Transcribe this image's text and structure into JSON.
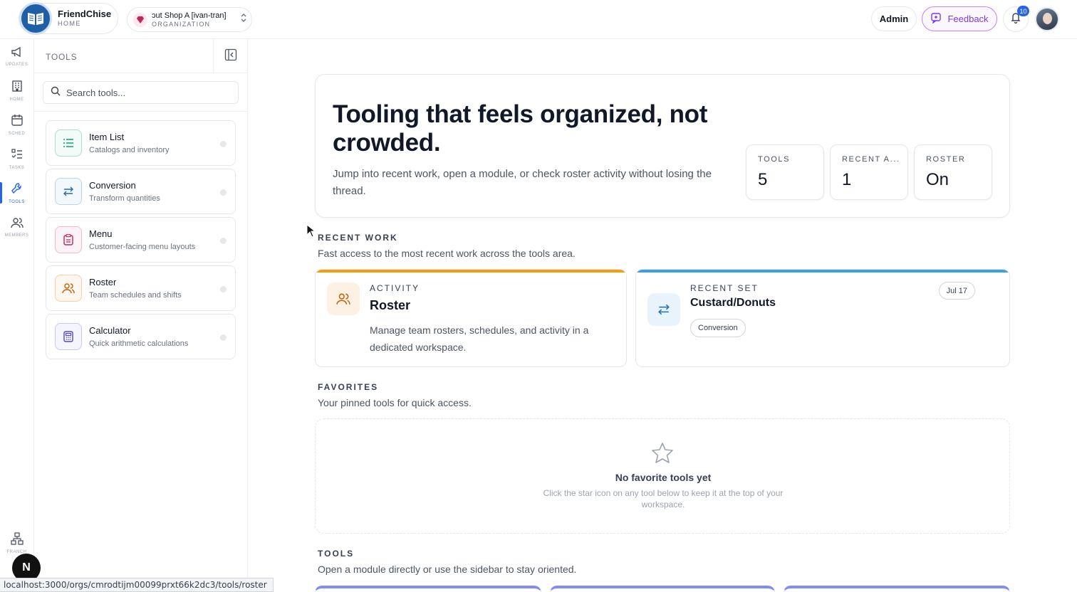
{
  "brand": {
    "name": "FriendChise",
    "subtitle": "HOME"
  },
  "org": {
    "name": "ɔut Shop A [ivan-tran]",
    "subtitle": "ORGANIZATION"
  },
  "header": {
    "admin_label": "Admin",
    "feedback_label": "Feedback",
    "notification_count": "10"
  },
  "rail": {
    "items": [
      {
        "label": "UPDATES",
        "icon": "megaphone-icon"
      },
      {
        "label": "HOME",
        "icon": "building-icon"
      },
      {
        "label": "SCHED",
        "icon": "calendar-icon"
      },
      {
        "label": "TASKS",
        "icon": "task-list-icon"
      },
      {
        "label": "TOOLS",
        "icon": "wrench-icon",
        "active": true
      },
      {
        "label": "MEMBERS",
        "icon": "users-icon"
      },
      {
        "label": "FRANCH",
        "icon": "network-icon"
      }
    ],
    "next_badge": "N"
  },
  "tools_panel": {
    "title": "TOOLS",
    "search_placeholder": "Search tools...",
    "tools": [
      {
        "name": "Item List",
        "desc": "Catalogs and inventory",
        "icon": "list-icon",
        "color": "#0f9f6e"
      },
      {
        "name": "Conversion",
        "desc": "Transform quantities",
        "icon": "arrows-swap-icon",
        "color": "#1d6fb8"
      },
      {
        "name": "Menu",
        "desc": "Customer-facing menu layouts",
        "icon": "clipboard-icon",
        "color": "#c0265a"
      },
      {
        "name": "Roster",
        "desc": "Team schedules and shifts",
        "icon": "users-icon",
        "color": "#c2620f"
      },
      {
        "name": "Calculator",
        "desc": "Quick arithmetic calculations",
        "icon": "calculator-icon",
        "color": "#4f46e5"
      }
    ]
  },
  "hero": {
    "title": "Tooling that feels organized, not crowded.",
    "subtitle": "Jump into recent work, open a module, or check roster activity without losing the thread.",
    "stats": [
      {
        "label": "TOOLS",
        "value": "5"
      },
      {
        "label": "RECENT A...",
        "value": "1"
      },
      {
        "label": "ROSTER",
        "value": "On"
      }
    ]
  },
  "recent_work": {
    "title": "RECENT WORK",
    "subtitle": "Fast access to the most recent work across the tools area.",
    "activity": {
      "kicker": "ACTIVITY",
      "title": "Roster",
      "desc": "Manage team rosters, schedules, and activity in a dedicated workspace.",
      "bar_color": "#f59e0b"
    },
    "recent_set": {
      "kicker": "RECENT SET",
      "title": "Custard/Donuts",
      "tag": "Conversion",
      "date": "Jul 17",
      "bar_color": "#3b9ee8"
    }
  },
  "favorites": {
    "title": "FAVORITES",
    "subtitle": "Your pinned tools for quick access.",
    "empty_title": "No favorite tools yet",
    "empty_desc": "Click the star icon on any tool below to keep it at the top of your workspace."
  },
  "tools_section": {
    "title": "TOOLS",
    "subtitle": "Open a module directly or use the sidebar to stay oriented."
  },
  "status_url": "localhost:3000/orgs/cmrodtijm00099prxt66k2dc3/tools/roster"
}
